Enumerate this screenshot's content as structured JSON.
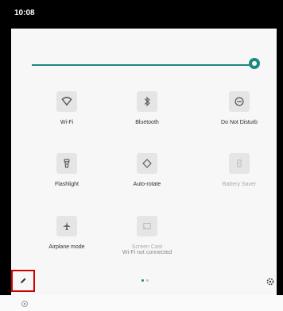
{
  "status_bar": {
    "time": "10:08"
  },
  "brightness": {
    "level": 0.99
  },
  "tiles": [
    {
      "id": "wifi",
      "label": "Wi-Fi",
      "icon": "wifi-icon",
      "active": false
    },
    {
      "id": "bluetooth",
      "label": "Bluetooth",
      "icon": "bluetooth-icon",
      "active": false
    },
    {
      "id": "dnd",
      "label": "Do Not Disturb",
      "icon": "do-not-disturb-icon",
      "active": false
    },
    {
      "id": "flashlight",
      "label": "Flashlight",
      "icon": "flashlight-icon",
      "active": false
    },
    {
      "id": "autorotate",
      "label": "Auto-rotate",
      "icon": "auto-rotate-icon",
      "active": false
    },
    {
      "id": "battery",
      "label": "Battery Saver",
      "icon": "battery-saver-icon",
      "active": false,
      "disabled": true
    },
    {
      "id": "airplane",
      "label": "Airplane mode",
      "icon": "airplane-icon",
      "active": false
    },
    {
      "id": "cast",
      "label": "Screen Cast",
      "sublabel": "Wi-Fi not connected",
      "icon": "cast-icon",
      "active": false,
      "disabled": true
    }
  ],
  "pager": {
    "pages": 2,
    "current": 1
  },
  "footer": {
    "edit_icon": "pencil-icon",
    "settings_icon": "gear-icon"
  },
  "colors": {
    "accent": "#1b8a80",
    "tile_bg": "#e5e5e5",
    "highlight": "#cc0000"
  }
}
